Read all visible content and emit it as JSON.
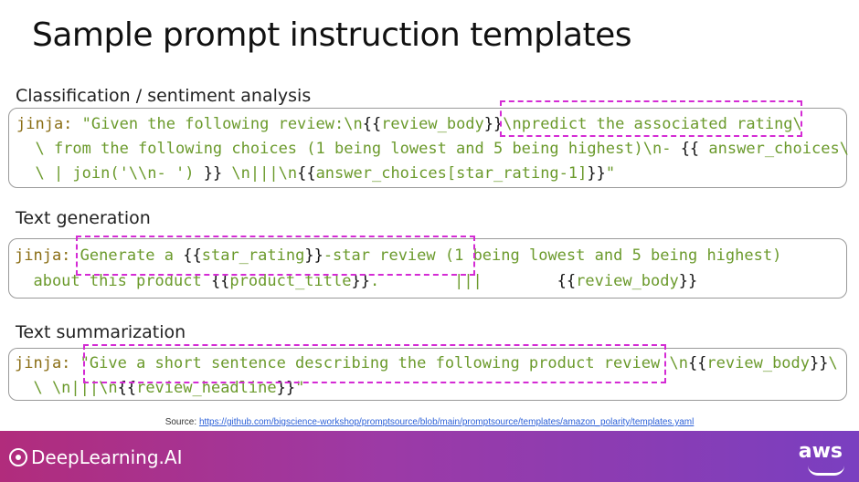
{
  "slide_title": "Sample prompt instruction templates",
  "sections": [
    {
      "label": "Classification / sentiment analysis",
      "lines": [
        [
          {
            "t": "jinja: ",
            "c": "kw"
          },
          {
            "t": "\"Given the following review:\\n",
            "c": "str"
          },
          {
            "t": "{{",
            "c": "br"
          },
          {
            "t": "review_body",
            "c": "str"
          },
          {
            "t": "}}",
            "c": "br"
          },
          {
            "t": "\\npredict the associated rating\\",
            "c": "str"
          }
        ],
        [
          {
            "t": "  \\ from the following choices (1 being lowest and 5 being highest)\\n- ",
            "c": "str"
          },
          {
            "t": "{{",
            "c": "br"
          },
          {
            "t": " answer_choices\\",
            "c": "str"
          }
        ],
        [
          {
            "t": "  \\ | join('\\\\n- ') ",
            "c": "str"
          },
          {
            "t": "}}",
            "c": "br"
          },
          {
            "t": " \\n|||\\n",
            "c": "str"
          },
          {
            "t": "{{",
            "c": "br"
          },
          {
            "t": "answer_choices[star_rating-1]",
            "c": "str"
          },
          {
            "t": "}}",
            "c": "br"
          },
          {
            "t": "\"",
            "c": "str"
          }
        ]
      ]
    },
    {
      "label": "Text generation",
      "lines": [
        [
          {
            "t": "jinja: ",
            "c": "kw"
          },
          {
            "t": "Generate a ",
            "c": "str"
          },
          {
            "t": "{{",
            "c": "br"
          },
          {
            "t": "star_rating",
            "c": "str"
          },
          {
            "t": "}}",
            "c": "br"
          },
          {
            "t": "-star review (1 being lowest and 5 being highest)",
            "c": "str"
          }
        ],
        [
          {
            "t": "  about this product ",
            "c": "str"
          },
          {
            "t": "{{",
            "c": "br"
          },
          {
            "t": "product_title",
            "c": "str"
          },
          {
            "t": "}}",
            "c": "br"
          },
          {
            "t": ".        |||        ",
            "c": "str"
          },
          {
            "t": "{{",
            "c": "br"
          },
          {
            "t": "review_body",
            "c": "str"
          },
          {
            "t": "}}",
            "c": "br"
          }
        ]
      ]
    },
    {
      "label": "Text summarization",
      "lines": [
        [
          {
            "t": "jinja: ",
            "c": "kw"
          },
          {
            "t": "\"Give a short sentence describing the following product review ",
            "c": "str"
          },
          {
            "t": "\\n",
            "c": "str"
          },
          {
            "t": "{{",
            "c": "br"
          },
          {
            "t": "review_body",
            "c": "str"
          },
          {
            "t": "}}",
            "c": "br"
          },
          {
            "t": "\\",
            "c": "str"
          }
        ],
        [
          {
            "t": "  \\ \\n|||\\n",
            "c": "str"
          },
          {
            "t": "{{",
            "c": "br"
          },
          {
            "t": "review_headline",
            "c": "str"
          },
          {
            "t": "}}",
            "c": "br"
          },
          {
            "t": "\"",
            "c": "str"
          }
        ]
      ]
    }
  ],
  "source_label": "Source:",
  "source_url": "https://github.com/bigscience-workshop/promptsource/blob/main/promptsource/templates/amazon_polarity/templates.yaml",
  "brand": "DeepLearning.AI",
  "partner": "aws"
}
